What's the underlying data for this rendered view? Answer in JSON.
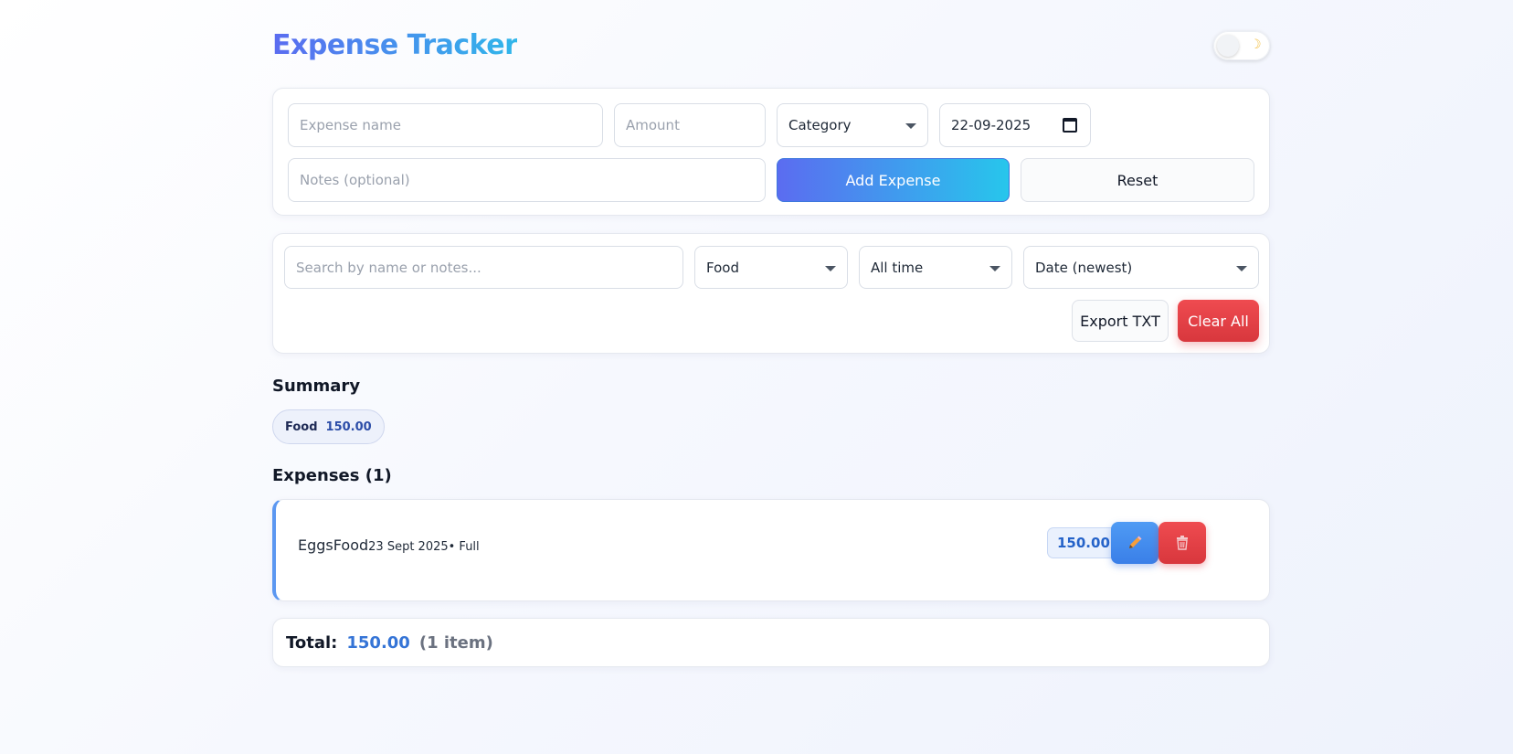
{
  "app": {
    "title": "Expense Tracker",
    "theme_icon": "moon-icon"
  },
  "form": {
    "name_placeholder": "Expense name",
    "amount_placeholder": "Amount",
    "category_value": "Category",
    "date_value": "22-09-2025",
    "notes_placeholder": "Notes (optional)",
    "add_label": "Add Expense",
    "reset_label": "Reset"
  },
  "filters": {
    "search_placeholder": "Search by name or notes...",
    "category_value": "Food",
    "period_value": "All time",
    "sort_value": "Date (newest)",
    "export_label": "Export TXT",
    "clear_label": "Clear All"
  },
  "summary": {
    "heading": "Summary",
    "chips": [
      {
        "category": "Food",
        "amount": "150.00"
      }
    ]
  },
  "expenses": {
    "heading": "Expenses (1)",
    "items": [
      {
        "name": "Eggs",
        "category": "Food",
        "meta": "23 Sept 2025• Full",
        "amount": "150.00",
        "edit_icon": "pencil-icon",
        "delete_icon": "trash-icon"
      }
    ]
  },
  "total": {
    "label": "Total:",
    "value": "150.00",
    "count": "(1 item)"
  },
  "colors": {
    "accent_start": "#5b6cf0",
    "accent_end": "#27c6ec",
    "danger": "#e0393f",
    "amount_blue": "#2563c9"
  }
}
